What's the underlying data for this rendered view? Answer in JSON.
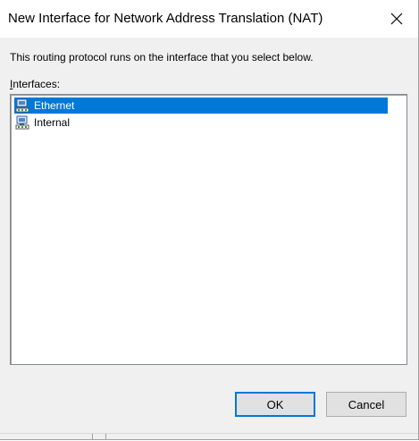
{
  "window": {
    "title": "New Interface for Network Address Translation (NAT)",
    "close_icon": "close-icon"
  },
  "dialog": {
    "description": "This routing protocol runs on the interface that you select below.",
    "interfaces_label_accel": "I",
    "interfaces_label_rest": "nterfaces:"
  },
  "interfaces": [
    {
      "name": "Ethernet",
      "icon": "network-interface-icon",
      "selected": true
    },
    {
      "name": "Internal",
      "icon": "network-interface-icon",
      "selected": false
    }
  ],
  "buttons": {
    "ok_label": "OK",
    "cancel_label": "Cancel"
  },
  "colors": {
    "selection": "#0078d7",
    "dialog_bg": "#f0f0f0"
  }
}
